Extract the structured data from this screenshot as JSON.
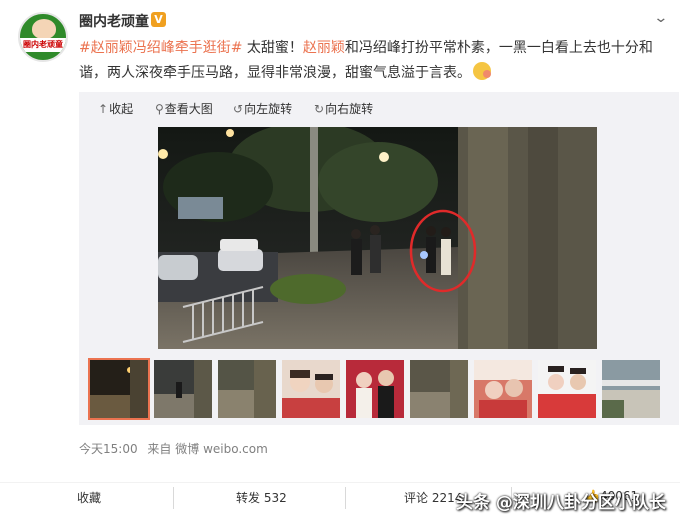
{
  "user": {
    "name": "圈内老顽童",
    "verified_badge": "V",
    "avatar_text": "圈内老顽童"
  },
  "post": {
    "tag": "#赵丽颖冯绍峰牵手逛街#",
    "text_1": " 太甜蜜！",
    "mention": "赵丽颖",
    "text_2": "和冯绍峰打扮平常朴素，一黑一白看上去也十分和谐，两人深夜牵手压马路，显得非常浪漫，甜蜜气息溢于言表。"
  },
  "toolbar": {
    "collapse": "收起",
    "view_large": "查看大图",
    "rotate_left": "向左旋转",
    "rotate_right": "向右旋转"
  },
  "meta": {
    "time": "今天15:00",
    "source_prefix": "来自",
    "source": "微博 weibo.com"
  },
  "actions": {
    "favorite": "收藏",
    "repost": "转发 532",
    "comment": "评论 2214",
    "like": "40061"
  },
  "watermark": "头条 @深圳八卦分区小队长",
  "colors": {
    "accent": "#eb7350",
    "highlight_circle": "#e02a2a"
  }
}
